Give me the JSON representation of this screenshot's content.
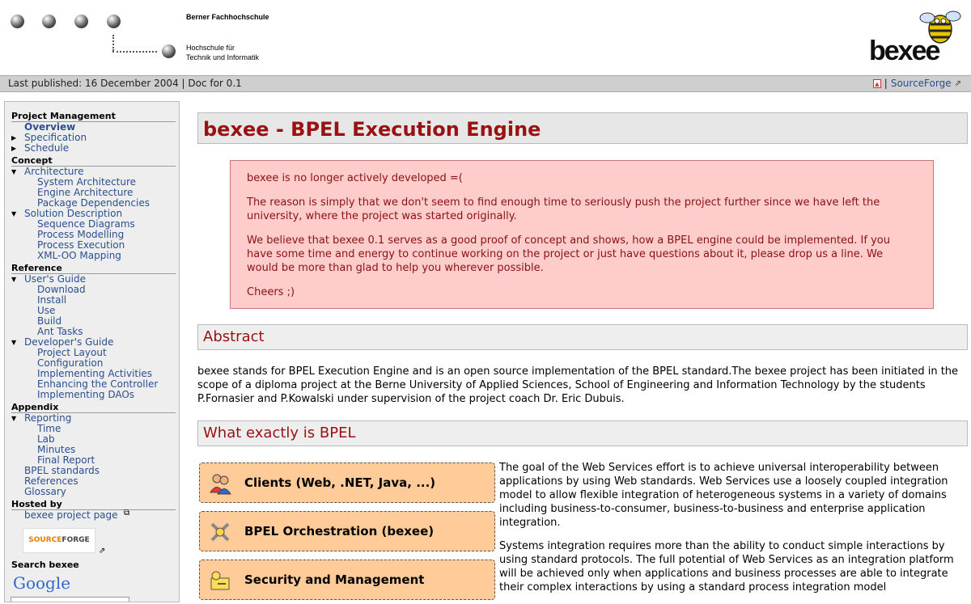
{
  "header": {
    "org_name": "Berner Fachhochschule",
    "org_sub1": "Hochschule für",
    "org_sub2": "Technik und Informatik",
    "logo_text": "bexee"
  },
  "pubbar": {
    "published": "Last published: 16 December 2004 | Doc for 0.1",
    "separator": "|",
    "sourceforge": "SourceForge",
    "pdf_icon": "pdf-icon",
    "external_icon": "external-link-icon"
  },
  "sidebar": {
    "sections": {
      "project_management": "Project Management",
      "concept": "Concept",
      "reference": "Reference",
      "appendix": "Appendix",
      "hosted_by": "Hosted by",
      "search": "Search bexee"
    },
    "items": {
      "overview": "Overview",
      "specification": "Specification",
      "schedule": "Schedule",
      "architecture": "Architecture",
      "system_architecture": "System Architecture",
      "engine_architecture": "Engine Architecture",
      "package_dependencies": "Package Dependencies",
      "solution_description": "Solution Description",
      "sequence_diagrams": "Sequence Diagrams",
      "process_modelling": "Process Modelling",
      "process_execution": "Process Execution",
      "xml_oo_mapping": "XML-OO Mapping",
      "users_guide": "User's Guide",
      "download": "Download",
      "install": "Install",
      "use": "Use",
      "build": "Build",
      "ant_tasks": "Ant Tasks",
      "developers_guide": "Developer's Guide",
      "project_layout": "Project Layout",
      "configuration": "Configuration",
      "implementing_activities": "Implementing Activities",
      "enhancing_controller": "Enhancing the Controller",
      "implementing_daos": "Implementing DAOs",
      "reporting": "Reporting",
      "time": "Time",
      "lab": "Lab",
      "minutes": "Minutes",
      "final_report": "Final Report",
      "bpel_standards": "BPEL standards",
      "references": "References",
      "glossary": "Glossary",
      "project_page": "bexee project page"
    },
    "sourceforge_logo_a": "SOURCE",
    "sourceforge_logo_b": "FORGE",
    "google_logo": "Google"
  },
  "main": {
    "title": "bexee - BPEL Execution Engine",
    "notice": {
      "p1": "bexee is no longer actively developed =(",
      "p2": "The reason is simply that we don't seem to find enough time to seriously push the project further since we have left the university, where the project was started originally.",
      "p3": "We believe that bexee 0.1 serves as a good proof of concept and shows, how a BPEL engine could be implemented. If you have some time and energy to continue working on the project or just have questions about it, please drop us a line. We would be more than glad to help you wherever possible.",
      "p4": "Cheers ;)"
    },
    "abstract_heading": "Abstract",
    "abstract_text": "bexee stands for BPEL Execution Engine and is an open source implementation of the BPEL standard.The bexee project has been initiated in the scope of a diploma project at the Berne University of Applied Sciences, School of Engineering and Information Technology by the students P.Fornasier and P.Kowalski under supervision of the project coach Dr. Eric Dubuis.",
    "bpel_heading": "What exactly is BPEL",
    "stack": {
      "clients": "Clients (Web, .NET, Java, ...)",
      "orchestration": "BPEL Orchestration (bexee)",
      "security": "Security and Management"
    },
    "bpel_p1": "The goal of the Web Services effort is to achieve universal interoperability between applications by using Web standards. Web Services use a loosely coupled integration model to allow flexible integration of heterogeneous systems in a variety of domains including business-to-consumer, business-to-business and enterprise application integration.",
    "bpel_p2": "Systems integration requires more than the ability to conduct simple interactions by using standard protocols. The full potential of Web Services as an integration platform will be achieved only when applications and business processes are able to integrate their complex interactions by using a standard process integration model"
  }
}
